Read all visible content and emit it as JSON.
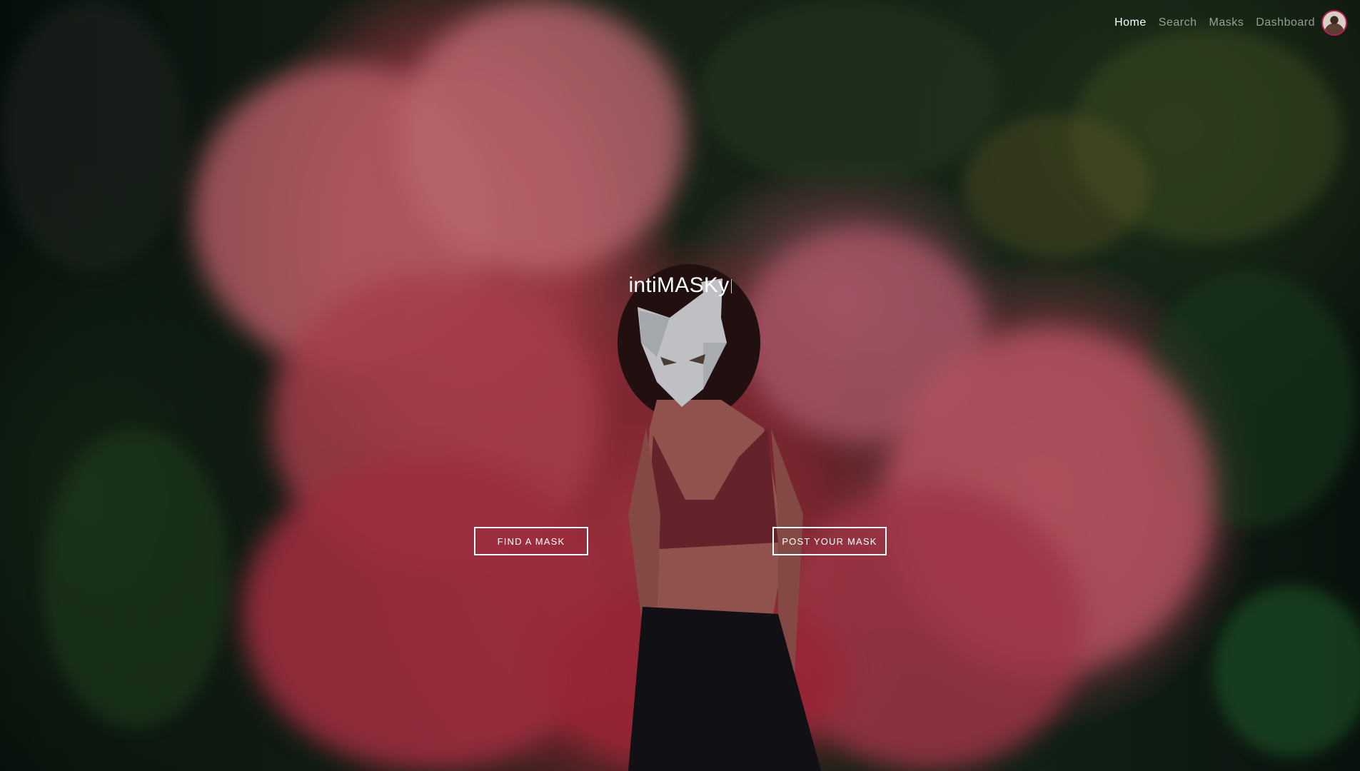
{
  "nav": {
    "items": [
      {
        "label": "Home",
        "active": true
      },
      {
        "label": "Search",
        "active": false
      },
      {
        "label": "Masks",
        "active": false
      },
      {
        "label": "Dashboard",
        "active": false
      }
    ],
    "avatar_icon": "user-avatar",
    "accent_color": "#c2185b"
  },
  "hero": {
    "title": "intiMASKy",
    "find_button": "FIND A MASK",
    "post_button": "POST YOUR MASK",
    "background_colors": {
      "smoke": "#c8465a",
      "foliage": "#1b2a1a"
    }
  }
}
